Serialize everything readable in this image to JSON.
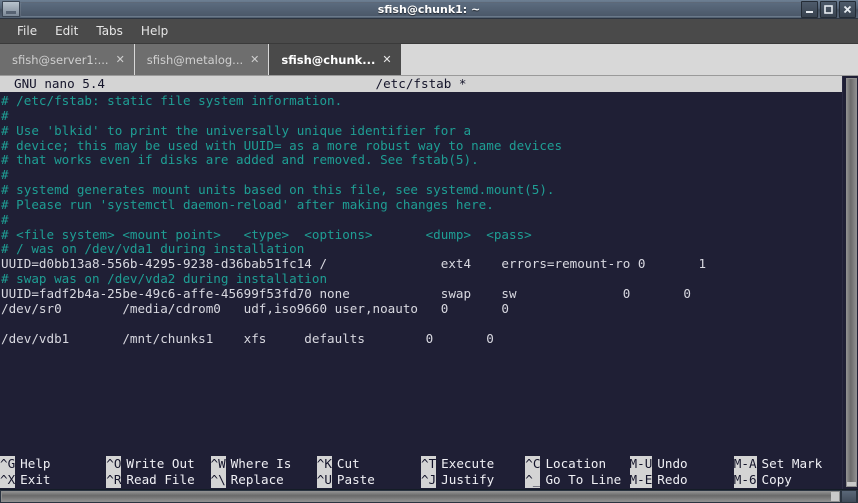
{
  "window": {
    "title": "sfish@chunk1: ~",
    "menu_icon": "terminal-icon",
    "buttons": {
      "minimize": "minimize-icon",
      "maximize": "maximize-icon",
      "close": "close-icon"
    }
  },
  "menubar": {
    "items": [
      {
        "label": "File"
      },
      {
        "label": "Edit"
      },
      {
        "label": "Tabs"
      },
      {
        "label": "Help"
      }
    ]
  },
  "tabbar": {
    "tabs": [
      {
        "label": "sfish@server1:...",
        "close": "✕",
        "active": false
      },
      {
        "label": "sfish@metalog...",
        "close": "✕",
        "active": false
      },
      {
        "label": "sfish@chunk...",
        "close": "✕",
        "active": true
      }
    ]
  },
  "nano": {
    "version": "GNU nano 5.4",
    "filename": "/etc/fstab *",
    "lines": [
      {
        "text": "# /etc/fstab: static file system information.",
        "comment": true
      },
      {
        "text": "#",
        "comment": true
      },
      {
        "text": "# Use 'blkid' to print the universally unique identifier for a",
        "comment": true
      },
      {
        "text": "# device; this may be used with UUID= as a more robust way to name devices",
        "comment": true
      },
      {
        "text": "# that works even if disks are added and removed. See fstab(5).",
        "comment": true
      },
      {
        "text": "#",
        "comment": true
      },
      {
        "text": "# systemd generates mount units based on this file, see systemd.mount(5).",
        "comment": true
      },
      {
        "text": "# Please run 'systemctl daemon-reload' after making changes here.",
        "comment": true
      },
      {
        "text": "#",
        "comment": true
      },
      {
        "text": "# <file system> <mount point>   <type>  <options>       <dump>  <pass>",
        "comment": true
      },
      {
        "text": "# / was on /dev/vda1 during installation",
        "comment": true
      },
      {
        "text": "UUID=d0bb13a8-556b-4295-9238-d36bab51fc14 /               ext4    errors=remount-ro 0       1",
        "comment": false
      },
      {
        "text": "# swap was on /dev/vda2 during installation",
        "comment": true
      },
      {
        "text": "UUID=fadf2b4a-25be-49c6-affe-45699f53fd70 none            swap    sw              0       0",
        "comment": false
      },
      {
        "text": "/dev/sr0        /media/cdrom0   udf,iso9660 user,noauto   0       0",
        "comment": false
      },
      {
        "text": "",
        "comment": false
      },
      {
        "text": "/dev/vdb1       /mnt/chunks1    xfs     defaults        0       0",
        "comment": false
      }
    ],
    "shortcuts_row1": [
      {
        "key": "^G",
        "label": "Help"
      },
      {
        "key": "^O",
        "label": "Write Out"
      },
      {
        "key": "^W",
        "label": "Where Is"
      },
      {
        "key": "^K",
        "label": "Cut"
      },
      {
        "key": "^T",
        "label": "Execute"
      },
      {
        "key": "^C",
        "label": "Location"
      },
      {
        "key": "M-U",
        "label": "Undo"
      },
      {
        "key": "M-A",
        "label": "Set Mark"
      }
    ],
    "shortcuts_row2": [
      {
        "key": "^X",
        "label": "Exit"
      },
      {
        "key": "^R",
        "label": "Read File"
      },
      {
        "key": "^\\",
        "label": "Replace"
      },
      {
        "key": "^U",
        "label": "Paste"
      },
      {
        "key": "^J",
        "label": "Justify"
      },
      {
        "key": "^_",
        "label": "Go To Line"
      },
      {
        "key": "M-E",
        "label": "Redo"
      },
      {
        "key": "M-6",
        "label": "Copy"
      }
    ]
  },
  "colors": {
    "terminal_bg": "#1f1f35",
    "comment_fg": "#1f9e94",
    "text_fg": "#d8d8e0",
    "nano_bar_bg": "#d4d4d4",
    "titlebar_bg": "#536275",
    "menubar_bg": "#4a4a4a",
    "tabbar_bg": "#d8d8d8"
  }
}
